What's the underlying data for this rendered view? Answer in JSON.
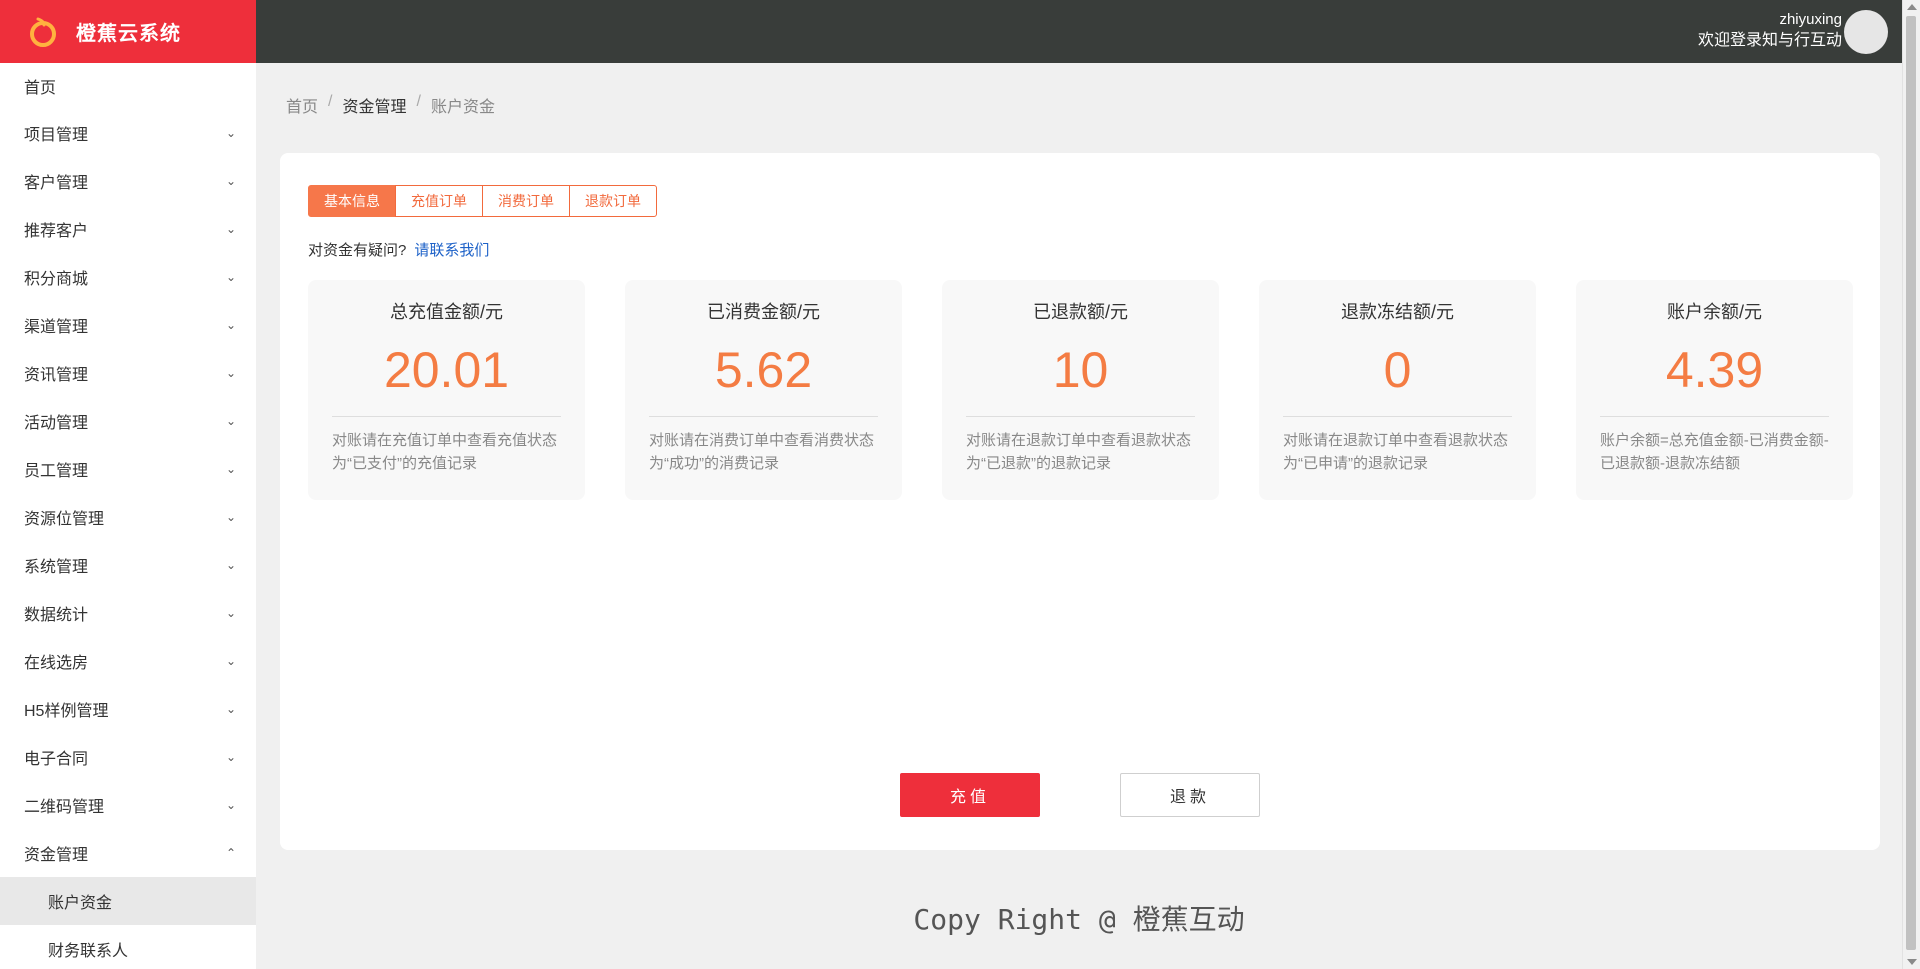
{
  "app": {
    "name": "橙蕉云系统",
    "logo_icon": "orange-logo-icon",
    "brand_color": "#ee2f3b",
    "accent_color": "#f47c43"
  },
  "header": {
    "username": "zhiyuxing",
    "greeting": "欢迎登录知与行互动"
  },
  "sidebar": {
    "items": [
      {
        "label": "首页",
        "expandable": false
      },
      {
        "label": "项目管理",
        "expandable": true
      },
      {
        "label": "客户管理",
        "expandable": true
      },
      {
        "label": "推荐客户",
        "expandable": true
      },
      {
        "label": "积分商城",
        "expandable": true
      },
      {
        "label": "渠道管理",
        "expandable": true
      },
      {
        "label": "资讯管理",
        "expandable": true
      },
      {
        "label": "活动管理",
        "expandable": true
      },
      {
        "label": "员工管理",
        "expandable": true
      },
      {
        "label": "资源位管理",
        "expandable": true
      },
      {
        "label": "系统管理",
        "expandable": true
      },
      {
        "label": "数据统计",
        "expandable": true
      },
      {
        "label": "在线选房",
        "expandable": true
      },
      {
        "label": "H5样例管理",
        "expandable": true
      },
      {
        "label": "电子合同",
        "expandable": true
      },
      {
        "label": "二维码管理",
        "expandable": true
      },
      {
        "label": "资金管理",
        "expandable": true,
        "expanded": true
      }
    ],
    "sub_items": [
      {
        "label": "账户资金",
        "active": true
      },
      {
        "label": "财务联系人",
        "active": false
      }
    ]
  },
  "breadcrumb": {
    "home": "首页",
    "section": "资金管理",
    "current": "账户资金",
    "separator": "/"
  },
  "tabs": [
    {
      "label": "基本信息",
      "active": true
    },
    {
      "label": "充值订单",
      "active": false
    },
    {
      "label": "消费订单",
      "active": false
    },
    {
      "label": "退款订单",
      "active": false
    }
  ],
  "question": {
    "text": "对资金有疑问?",
    "link": "请联系我们"
  },
  "stats": [
    {
      "title": "总充值金额/元",
      "value": "20.01",
      "note": "对账请在充值订单中查看充值状态为“已支付”的充值记录"
    },
    {
      "title": "已消费金额/元",
      "value": "5.62",
      "note": "对账请在消费订单中查看消费状态为“成功”的消费记录"
    },
    {
      "title": "已退款额/元",
      "value": "10",
      "note": "对账请在退款订单中查看退款状态为“已退款”的退款记录"
    },
    {
      "title": "退款冻结额/元",
      "value": "0",
      "note": "对账请在退款订单中查看退款状态为“已申请”的退款记录"
    },
    {
      "title": "账户余额/元",
      "value": "4.39",
      "note": "账户余额=总充值金额-已消费金额-已退款额-退款冻结额"
    }
  ],
  "actions": {
    "recharge": "充值",
    "refund": "退款"
  },
  "footer": {
    "text": "Copy Right @ 橙蕉互动"
  }
}
